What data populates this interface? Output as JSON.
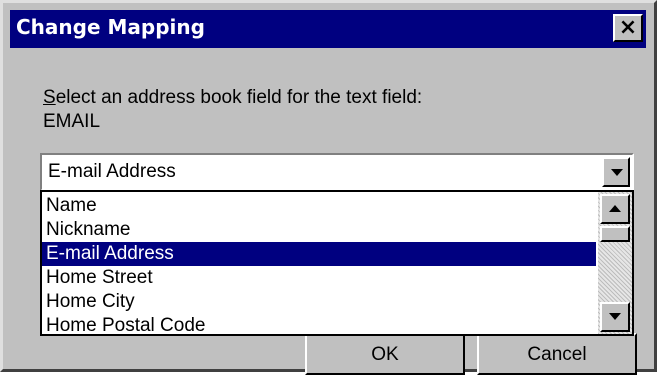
{
  "dialog": {
    "title": "Change Mapping",
    "close_label": "×"
  },
  "prompt": {
    "accelerator": "S",
    "text_rest": "elect an address book field for the text field:",
    "field_name": "EMAIL"
  },
  "combo": {
    "selected_value": "E-mail Address",
    "icons": {
      "arrow": "chevron-down-icon"
    }
  },
  "list": {
    "items": [
      "Name",
      "Nickname",
      "E-mail Address",
      "Home Street",
      "Home City",
      "Home Postal Code"
    ],
    "selected_index": 2
  },
  "buttons": {
    "ok_label": "OK",
    "cancel_label": "Cancel"
  },
  "colors": {
    "titlebar": "#000080",
    "face": "#c0c0c0",
    "selection": "#000080"
  }
}
